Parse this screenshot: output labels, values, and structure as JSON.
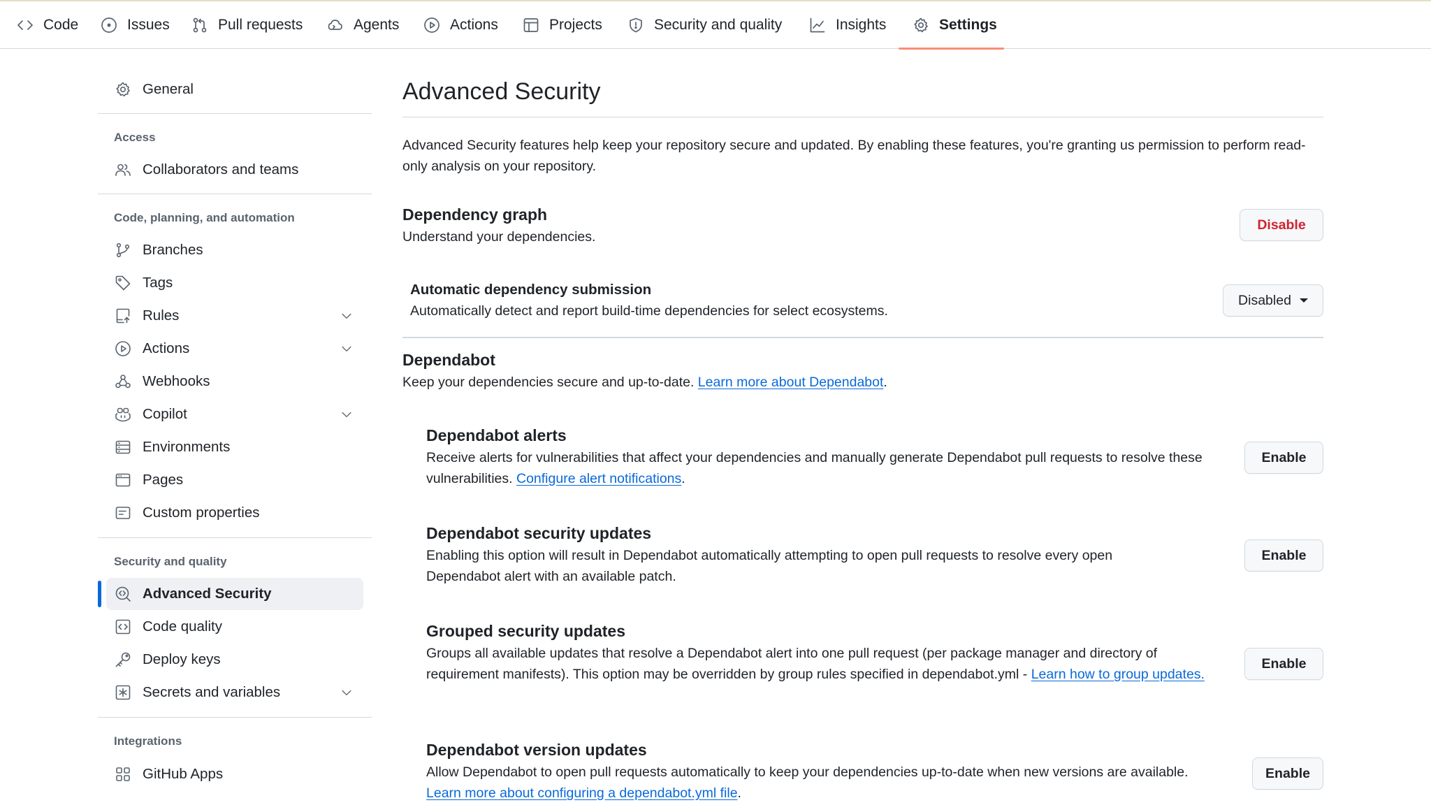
{
  "colors": {
    "accent": "#0969da",
    "danger": "#d1242f",
    "tab_underline": "#fd8c73"
  },
  "topnav": {
    "tabs": [
      {
        "label": "Code",
        "icon": "code-icon"
      },
      {
        "label": "Issues",
        "icon": "issue-opened-icon"
      },
      {
        "label": "Pull requests",
        "icon": "git-pull-request-icon"
      },
      {
        "label": "Agents",
        "icon": "agent-icon"
      },
      {
        "label": "Actions",
        "icon": "play-icon"
      },
      {
        "label": "Projects",
        "icon": "table-icon"
      },
      {
        "label": "Security and quality",
        "icon": "shield-icon"
      },
      {
        "label": "Insights",
        "icon": "graph-icon"
      },
      {
        "label": "Settings",
        "icon": "gear-icon",
        "active": true
      }
    ]
  },
  "sidebar": {
    "general": "General",
    "access_heading": "Access",
    "collaborators": "Collaborators and teams",
    "code_heading": "Code, planning, and automation",
    "branches": "Branches",
    "tags": "Tags",
    "rules": "Rules",
    "actions": "Actions",
    "webhooks": "Webhooks",
    "copilot": "Copilot",
    "environments": "Environments",
    "pages": "Pages",
    "custom_properties": "Custom properties",
    "security_heading": "Security and quality",
    "advanced_security": "Advanced Security",
    "code_quality": "Code quality",
    "deploy_keys": "Deploy keys",
    "secrets": "Secrets and variables",
    "integrations_heading": "Integrations",
    "github_apps": "GitHub Apps"
  },
  "main": {
    "title": "Advanced Security",
    "intro": "Advanced Security features help keep your repository secure and updated. By enabling these features, you're granting us permission to perform read-only analysis on your repository.",
    "dependency_graph": {
      "title": "Dependency graph",
      "desc": "Understand your dependencies.",
      "button": "Disable"
    },
    "auto_submission": {
      "title": "Automatic dependency submission",
      "desc": "Automatically detect and report build-time dependencies for select ecosystems.",
      "select_value": "Disabled"
    },
    "dependabot": {
      "title": "Dependabot",
      "desc": "Keep your dependencies secure and up-to-date.",
      "link": "Learn more about Dependabot",
      "tail": "."
    },
    "alerts": {
      "title": "Dependabot alerts",
      "desc": "Receive alerts for vulnerabilities that affect your dependencies and manually generate Dependabot pull requests to resolve these vulnerabilities.",
      "link": "Configure alert notifications",
      "tail": ".",
      "button": "Enable"
    },
    "security_updates": {
      "title": "Dependabot security updates",
      "desc": "Enabling this option will result in Dependabot automatically attempting to open pull requests to resolve every open Dependabot alert with an available patch.",
      "button": "Enable"
    },
    "grouped": {
      "title": "Grouped security updates",
      "desc": "Groups all available updates that resolve a Dependabot alert into one pull request (per package manager and directory of requirement manifests). This option may be overridden by group rules specified in dependabot.yml -",
      "link": "Learn how to group updates.",
      "button": "Enable"
    },
    "version_updates": {
      "title": "Dependabot version updates",
      "desc": "Allow Dependabot to open pull requests automatically to keep your dependencies up-to-date when new versions are available.",
      "link": "Learn more about configuring a dependabot.yml file",
      "tail": ".",
      "button": "Enable"
    }
  }
}
